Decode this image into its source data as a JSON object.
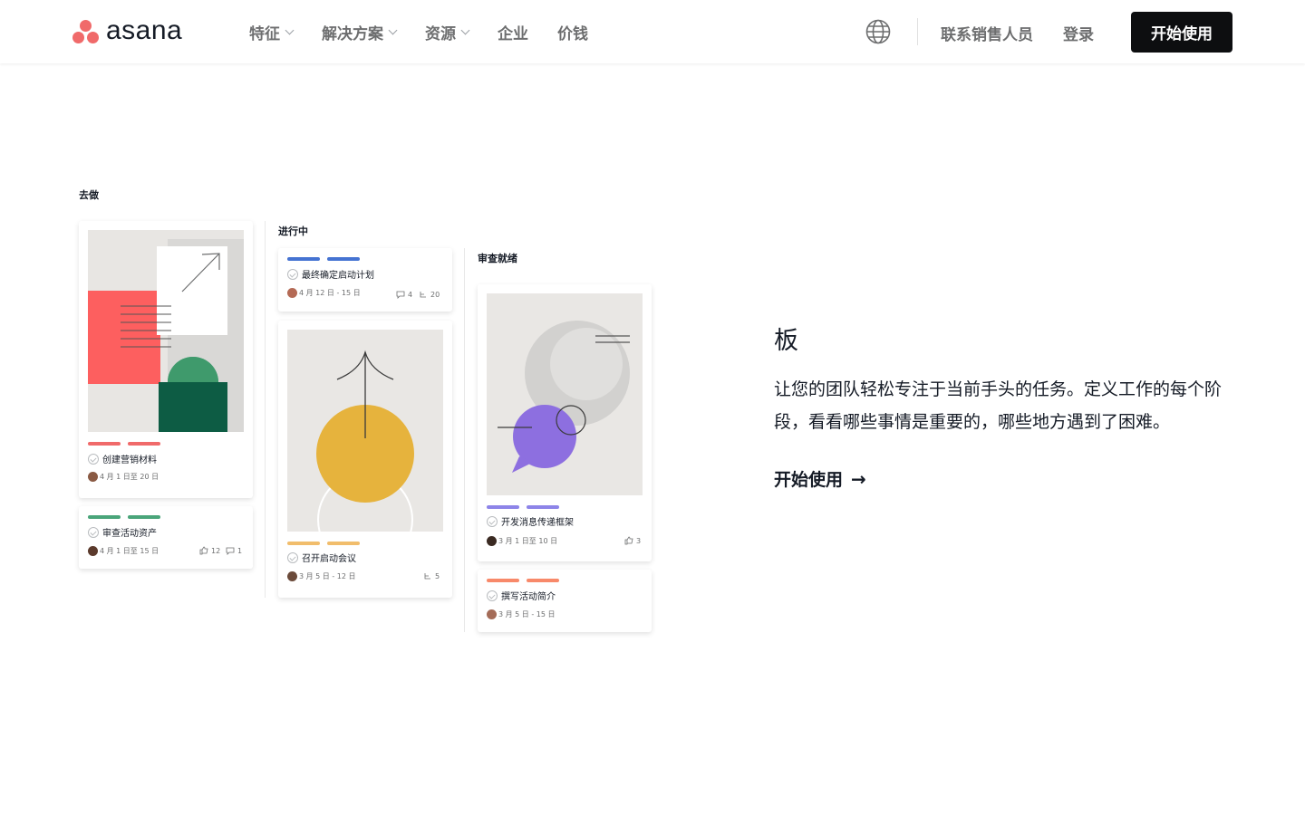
{
  "brand": {
    "name": "asana",
    "logo_color": "#f06a6a"
  },
  "nav": {
    "items": [
      {
        "label": "特征",
        "dropdown": true
      },
      {
        "label": "解决方案",
        "dropdown": true
      },
      {
        "label": "资源",
        "dropdown": true
      },
      {
        "label": "企业",
        "dropdown": false
      },
      {
        "label": "价钱",
        "dropdown": false
      }
    ],
    "globe_icon": "globe-icon",
    "contact_sales": "联系销售人员",
    "login": "登录",
    "cta": "开始使用"
  },
  "board": {
    "columns": [
      {
        "title": "去做",
        "cards": [
          {
            "task": "创建营销材料",
            "dates": "4 月 1 日至 20 日",
            "tag_color": "#f06a6a"
          },
          {
            "task": "审查活动资产",
            "dates": "4 月 1 日至 15 日",
            "likes": "12",
            "comments": "1",
            "tag_color": "#4aa57a"
          }
        ]
      },
      {
        "title": "进行中",
        "cards": [
          {
            "task": "最终确定启动计划",
            "dates": "4 月 12 日 - 15 日",
            "comments": "4",
            "subtasks": "20",
            "tag_color": "#4573d2"
          },
          {
            "task": "召开启动会议",
            "dates": "3 月 5 日 - 12 日",
            "subtasks": "5",
            "tag_color": "#f1bd6c"
          }
        ]
      },
      {
        "title": "审查就绪",
        "cards": [
          {
            "task": "开发消息传递框架",
            "dates": "3 月 1 日至 10 日",
            "likes": "3",
            "tag_color": "#8d84e8"
          },
          {
            "task": "撰写活动简介",
            "dates": "3 月 5 日 - 15 日",
            "tag_color": "#f8896a"
          }
        ]
      }
    ]
  },
  "feature": {
    "title": "板",
    "description": "让您的团队轻松专注于当前手头的任务。定义工作的每个阶段，看看哪些事情是重要的，哪些地方遇到了困难。",
    "link": "开始使用",
    "link_arrow": "→"
  }
}
